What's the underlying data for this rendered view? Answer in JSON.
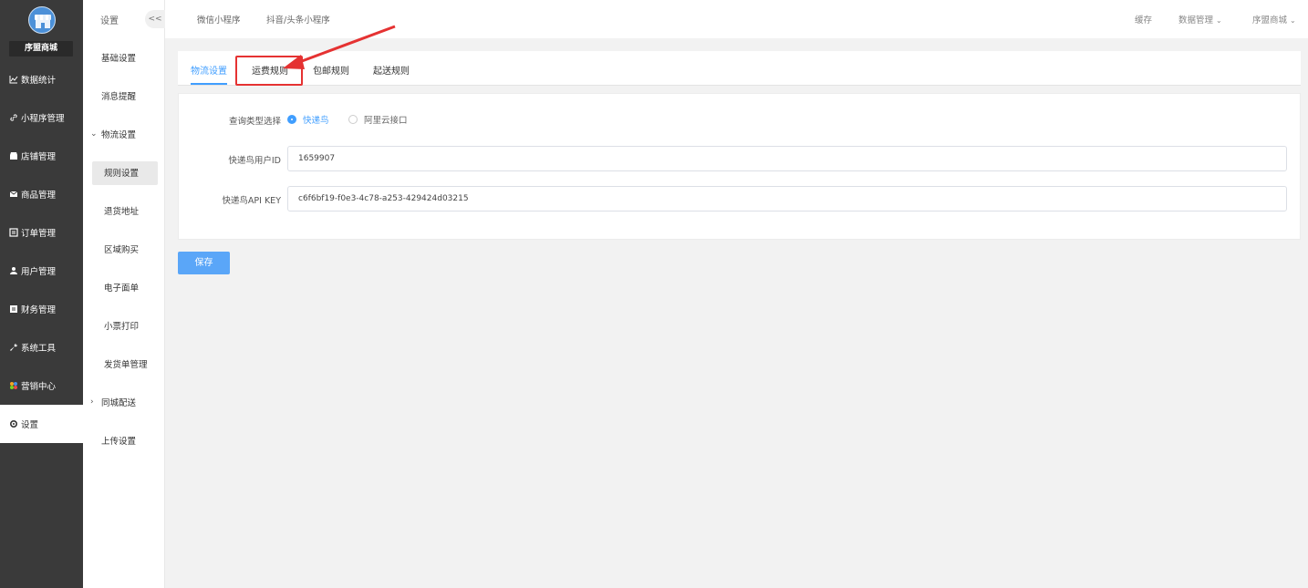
{
  "left_nav": {
    "store_name": "序盟商城",
    "items": [
      {
        "label": "数据统计",
        "icon": "chart-icon"
      },
      {
        "label": "小程序管理",
        "icon": "link-icon"
      },
      {
        "label": "店铺管理",
        "icon": "store-icon"
      },
      {
        "label": "商品管理",
        "icon": "mail-icon"
      },
      {
        "label": "订单管理",
        "icon": "list-icon"
      },
      {
        "label": "用户管理",
        "icon": "user-icon"
      },
      {
        "label": "财务管理",
        "icon": "finance-icon"
      },
      {
        "label": "系统工具",
        "icon": "wrench-icon"
      },
      {
        "label": "营销中心",
        "icon": "marketing-icon"
      },
      {
        "label": "设置",
        "icon": "gear-icon",
        "active": true
      }
    ]
  },
  "sub_nav": {
    "title": "设置",
    "collapse_label": "<<",
    "items": [
      {
        "label": "基础设置"
      },
      {
        "label": "消息提醒"
      },
      {
        "label": "物流设置",
        "expanded": true
      },
      {
        "label": "规则设置",
        "active": true
      },
      {
        "label": "退货地址"
      },
      {
        "label": "区域购买"
      },
      {
        "label": "电子面单"
      },
      {
        "label": "小票打印"
      },
      {
        "label": "发货单管理"
      },
      {
        "label": "同城配送",
        "expanded": false
      },
      {
        "label": "上传设置"
      }
    ]
  },
  "topbar": {
    "links": [
      "微信小程序",
      "抖音/头条小程序"
    ],
    "cache": "缓存",
    "data_manage": "数据管理",
    "store": "序盟商城"
  },
  "tabs": [
    {
      "label": "物流设置",
      "active": true
    },
    {
      "label": "运费规则"
    },
    {
      "label": "包邮规则"
    },
    {
      "label": "起送规则"
    }
  ],
  "form": {
    "query_type_label": "查询类型选择",
    "options": [
      {
        "label": "快递鸟",
        "checked": true
      },
      {
        "label": "阿里云接口",
        "checked": false
      }
    ],
    "user_id_label": "快递鸟用户ID",
    "user_id_value": "1659907",
    "api_key_label": "快递鸟API KEY",
    "api_key_value": "c6f6bf19-f0e3-4c78-a253-429424d03215"
  },
  "save_label": "保存",
  "colors": {
    "accent": "#409eff",
    "sidebar_bg": "#3a3a3a",
    "annotation": "#e53232"
  }
}
